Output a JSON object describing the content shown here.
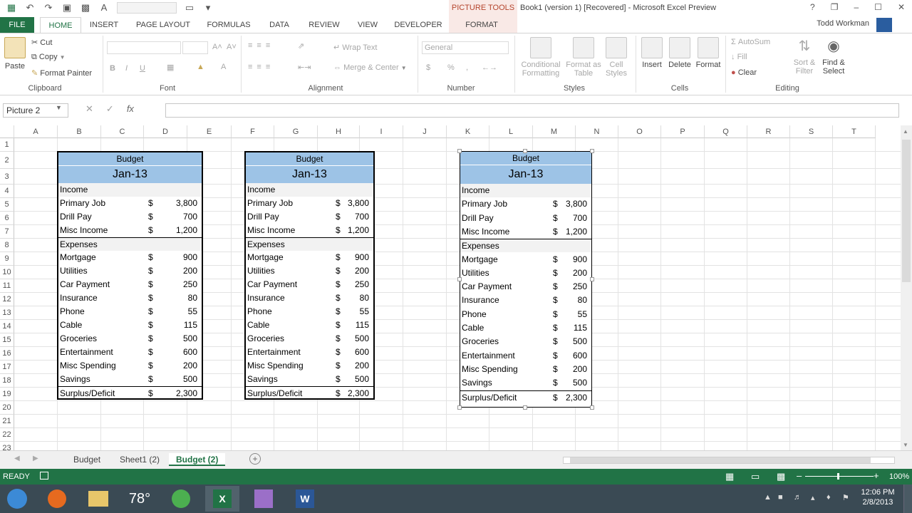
{
  "title_bar": {
    "picture_tools": "PICTURE TOOLS",
    "title": "Book1 (version 1) [Recovered] - Microsoft Excel Preview",
    "help": "?",
    "window_controls": [
      "❐",
      "–",
      "☐",
      "✕"
    ]
  },
  "tabs": {
    "file": "FILE",
    "home": "HOME",
    "insert": "INSERT",
    "page_layout": "PAGE LAYOUT",
    "formulas": "FORMULAS",
    "data": "DATA",
    "review": "REVIEW",
    "view": "VIEW",
    "developer": "DEVELOPER",
    "format": "FORMAT"
  },
  "user": "Todd Workman",
  "ribbon": {
    "clipboard": {
      "label": "Clipboard",
      "paste": "Paste",
      "cut": "Cut",
      "copy": "Copy",
      "format_painter": "Format Painter"
    },
    "font": {
      "label": "Font",
      "bold": "B",
      "italic": "I",
      "underline": "U",
      "increase": "A˄",
      "decrease": "A˅"
    },
    "alignment": {
      "label": "Alignment",
      "wrap_text": "Wrap Text",
      "merge_center": "Merge & Center"
    },
    "number": {
      "label": "Number",
      "format_value": "General",
      "currency": "$",
      "percent": "%",
      "comma": ","
    },
    "styles": {
      "label": "Styles",
      "conditional": "Conditional",
      "conditional2": "Formatting",
      "format_as": "Format as",
      "format_as2": "Table",
      "cell": "Cell",
      "cell2": "Styles"
    },
    "cells": {
      "label": "Cells",
      "insert": "Insert",
      "delete": "Delete",
      "format": "Format"
    },
    "editing": {
      "label": "Editing",
      "autosum": "AutoSum",
      "fill": "Fill",
      "clear": "Clear",
      "sort": "Sort &",
      "sort2": "Filter",
      "find": "Find &",
      "find2": "Select"
    }
  },
  "formula_bar": {
    "name_box": "Picture 2",
    "fx": "fx",
    "formula": ""
  },
  "columns": [
    "A",
    "B",
    "C",
    "D",
    "E",
    "F",
    "G",
    "H",
    "I",
    "J",
    "K",
    "L",
    "M",
    "N",
    "O",
    "P",
    "Q",
    "R",
    "S",
    "T"
  ],
  "rows": [
    "1",
    "2",
    "3",
    "4",
    "5",
    "6",
    "7",
    "8",
    "9",
    "10",
    "11",
    "12",
    "13",
    "14",
    "15",
    "16",
    "17",
    "18",
    "19",
    "20",
    "21",
    "22",
    "23"
  ],
  "budget": {
    "title": "Budget",
    "month": "Jan-13",
    "income_header": "Income",
    "expenses_header": "Expenses",
    "income": [
      {
        "label": "Primary Job",
        "cur": "$",
        "value": "3,800"
      },
      {
        "label": "Drill Pay",
        "cur": "$",
        "value": "700"
      },
      {
        "label": "Misc Income",
        "cur": "$",
        "value": "1,200"
      }
    ],
    "expenses": [
      {
        "label": "Mortgage",
        "cur": "$",
        "value": "900"
      },
      {
        "label": "Utilities",
        "cur": "$",
        "value": "200"
      },
      {
        "label": "Car Payment",
        "cur": "$",
        "value": "250"
      },
      {
        "label": "Insurance",
        "cur": "$",
        "value": "80"
      },
      {
        "label": "Phone",
        "cur": "$",
        "value": "55"
      },
      {
        "label": "Cable",
        "cur": "$",
        "value": "115"
      },
      {
        "label": "Groceries",
        "cur": "$",
        "value": "500"
      },
      {
        "label": "Entertainment",
        "cur": "$",
        "value": "600"
      },
      {
        "label": "Misc Spending",
        "cur": "$",
        "value": "200"
      },
      {
        "label": "Savings",
        "cur": "$",
        "value": "500"
      }
    ],
    "total": {
      "label": "Surplus/Deficit",
      "cur": "$",
      "value": "2,300"
    }
  },
  "sheet_tabs": [
    "Budget",
    "Sheet1 (2)",
    "Budget (2)"
  ],
  "add_sheet": "+",
  "status": {
    "ready": "READY",
    "zoom": "100%"
  },
  "taskbar": {
    "weather": "78°",
    "time": "12:06 PM",
    "date": "2/8/2013"
  }
}
